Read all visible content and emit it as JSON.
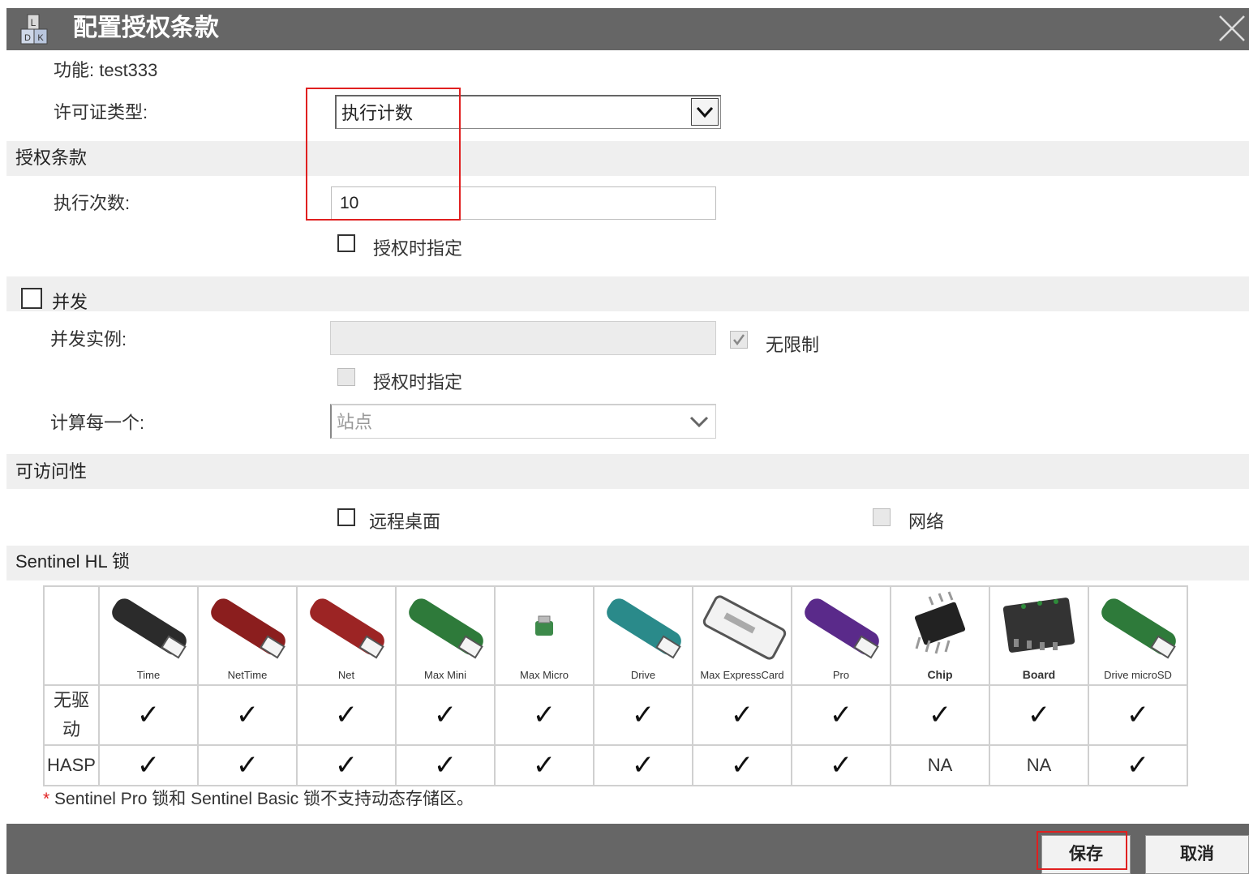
{
  "dialog": {
    "title": "配置授权条款",
    "close_icon": "close-icon",
    "feature_label": "功能: test333"
  },
  "license_type": {
    "label": "许可证类型:",
    "value": "执行计数"
  },
  "section_terms": {
    "title": "授权条款",
    "exec_count_label": "执行次数:",
    "exec_count_value": "10",
    "specify_at_grant": "授权时指定"
  },
  "section_concurrency": {
    "title": "并发",
    "instances_label": "并发实例:",
    "unlimited_label": "无限制",
    "specify_at_grant": "授权时指定",
    "count_per_label": "计算每一个:",
    "count_per_value": "站点"
  },
  "section_access": {
    "title": "可访问性",
    "remote_desktop": "远程桌面",
    "network": "网络"
  },
  "section_hl": {
    "title": "Sentinel HL 锁",
    "devices": [
      {
        "name": "Time",
        "color": "#2b2b2b"
      },
      {
        "name": "NetTime",
        "color": "#8b1e1e"
      },
      {
        "name": "Net",
        "color": "#9c2424"
      },
      {
        "name": "Max Mini",
        "color": "#2e7a3a"
      },
      {
        "name": "Max Micro",
        "color": "#3d8a4a"
      },
      {
        "name": "Drive",
        "color": "#2a8a8a"
      },
      {
        "name": "Max ExpressCard",
        "color": "#d8d8d8"
      },
      {
        "name": "Pro",
        "color": "#5a2a8a"
      },
      {
        "name": "Chip",
        "color": "#222222"
      },
      {
        "name": "Board",
        "color": "#333333"
      },
      {
        "name": "Drive microSD",
        "color": "#2e7a3a"
      }
    ],
    "rows": [
      {
        "label": "无驱动",
        "values": [
          "✓",
          "✓",
          "✓",
          "✓",
          "✓",
          "✓",
          "✓",
          "✓",
          "✓",
          "✓",
          "✓"
        ]
      },
      {
        "label": "HASP",
        "values": [
          "✓",
          "✓",
          "✓",
          "✓",
          "✓",
          "✓",
          "✓",
          "✓",
          "NA",
          "NA",
          "✓"
        ]
      }
    ],
    "note_star": "*",
    "note": " Sentinel Pro 锁和 Sentinel Basic 锁不支持动态存储区。"
  },
  "footer": {
    "save": "保存",
    "cancel": "取消"
  }
}
